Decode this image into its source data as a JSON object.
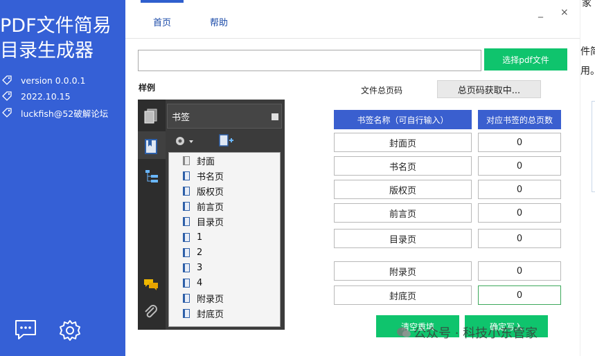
{
  "sidebar": {
    "title_line1": "PDF文件简易",
    "title_line2": "目录生成器",
    "version": "version  0.0.0.1",
    "date": "2022.10.15",
    "author": "luckfish@52破解论坛"
  },
  "tabs": [
    {
      "label": "首页"
    },
    {
      "label": "帮助"
    }
  ],
  "window": {
    "minimize": "_",
    "close": "×"
  },
  "file": {
    "path_value": "",
    "select_button": "选择pdf文件"
  },
  "sample_label": "样例",
  "total_pages": {
    "label": "文件总页码",
    "value": "总页码获取中..."
  },
  "table": {
    "header_name": "书签名称（可自行输入）",
    "header_pages": "对应书签的总页数",
    "rows": [
      {
        "name": "封面页",
        "pages": "0"
      },
      {
        "name": "书名页",
        "pages": "0"
      },
      {
        "name": "版权页",
        "pages": "0"
      },
      {
        "name": "前言页",
        "pages": "0"
      },
      {
        "name": "目录页",
        "pages": "0"
      },
      {
        "name": "附录页",
        "pages": "0"
      },
      {
        "name": "封底页",
        "pages": "0"
      }
    ]
  },
  "buttons": {
    "clear": "清空重填",
    "confirm": "确定写入"
  },
  "sample": {
    "panel_title": "书签",
    "items": [
      "封面",
      "书名页",
      "版权页",
      "前言页",
      "目录页",
      "1",
      "2",
      "3",
      "4",
      "附录页",
      "封底页"
    ]
  },
  "right_partial": {
    "line1": "家",
    "line2": "件简",
    "line3": "用。"
  },
  "watermark": "公众号 · 科技小东管家",
  "colors": {
    "sidebar_bg": "#3560d6",
    "accent_green": "#0fc46d",
    "header_blue": "#3a5fcf"
  }
}
